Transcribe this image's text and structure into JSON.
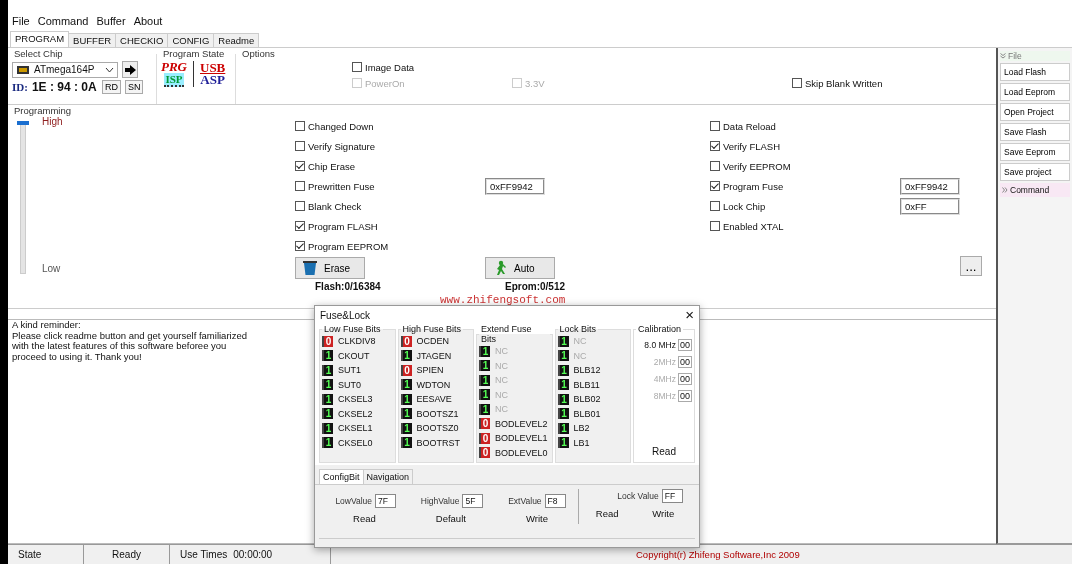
{
  "menu": [
    "File",
    "Command",
    "Buffer",
    "About"
  ],
  "tabs": [
    {
      "label": "PROGRAM",
      "selected": true
    },
    {
      "label": "BUFFER",
      "selected": false
    },
    {
      "label": "CHECKIO",
      "selected": false
    },
    {
      "label": "CONFIG",
      "selected": false
    },
    {
      "label": "Readme",
      "selected": false
    }
  ],
  "select_chip": {
    "title": "Select Chip",
    "chip": "ATmega164P",
    "id_label": "ID:",
    "id_value": "1E : 94 : 0A",
    "buttons": [
      "RD",
      "SN"
    ]
  },
  "program_state": {
    "title": "Program State",
    "prg": "PRG",
    "isp": "ISP",
    "usb": "USB",
    "asp": "ASP"
  },
  "options": {
    "title": "Options",
    "items": [
      {
        "label": "Image Data",
        "checked": false,
        "disabled": false
      },
      {
        "label": "PowerOn",
        "checked": false,
        "disabled": true
      },
      {
        "label": "3.3V",
        "checked": false,
        "disabled": true
      },
      {
        "label": "Skip Blank Written",
        "checked": false,
        "disabled": false
      }
    ]
  },
  "programming": {
    "title": "Programming",
    "high": "High",
    "low": "Low",
    "level": 1,
    "left": [
      {
        "label": "Changed Down",
        "checked": false
      },
      {
        "label": "Verify Signature",
        "checked": false
      },
      {
        "label": "Chip Erase",
        "checked": true
      },
      {
        "label": "Prewritten Fuse",
        "checked": false,
        "value": "0xFF9942"
      },
      {
        "label": "Blank Check",
        "checked": false
      },
      {
        "label": "Program FLASH",
        "checked": true
      },
      {
        "label": "Program EEPROM",
        "checked": true
      }
    ],
    "right": [
      {
        "label": "Data Reload",
        "checked": false
      },
      {
        "label": "Verify FLASH",
        "checked": true
      },
      {
        "label": "Verify EEPROM",
        "checked": false
      },
      {
        "label": "Program Fuse",
        "checked": true,
        "value": "0xFF9942"
      },
      {
        "label": "Lock Chip",
        "checked": false,
        "value": "0xFF"
      },
      {
        "label": "Enabled XTAL",
        "checked": false
      }
    ],
    "erase": "Erase",
    "flash": "Flash:0/16384",
    "auto": "Auto",
    "eprom": "Eprom:0/512",
    "more": "...",
    "site": "www.zhifengsoft.com"
  },
  "reminder": "A kind reminder:\nPlease click readme button and get yourself familiarized\nwith the latest features of this software beforee you\nproceed to using it. Thank you!",
  "side": {
    "file": "File",
    "items": [
      "Load Flash",
      "Load Eeprom",
      "Open Project",
      "Save Flash",
      "Save Eeprom",
      "Save project"
    ],
    "command": "Command"
  },
  "dialog": {
    "title": "Fuse&Lock",
    "close": "×",
    "groups": [
      {
        "title": "Low Fuse Bits",
        "bits": [
          {
            "bit": "0",
            "on": false,
            "name": "CLKDIV8",
            "disabled": false
          },
          {
            "bit": "1",
            "on": true,
            "name": "CKOUT",
            "disabled": false
          },
          {
            "bit": "1",
            "on": true,
            "name": "SUT1",
            "disabled": false
          },
          {
            "bit": "1",
            "on": true,
            "name": "SUT0",
            "disabled": false
          },
          {
            "bit": "1",
            "on": true,
            "name": "CKSEL3",
            "disabled": false
          },
          {
            "bit": "1",
            "on": true,
            "name": "CKSEL2",
            "disabled": false
          },
          {
            "bit": "1",
            "on": true,
            "name": "CKSEL1",
            "disabled": false
          },
          {
            "bit": "1",
            "on": true,
            "name": "CKSEL0",
            "disabled": false
          }
        ]
      },
      {
        "title": "High Fuse Bits",
        "bits": [
          {
            "bit": "0",
            "on": false,
            "name": "OCDEN",
            "disabled": false
          },
          {
            "bit": "1",
            "on": true,
            "name": "JTAGEN",
            "disabled": false
          },
          {
            "bit": "0",
            "on": false,
            "name": "SPIEN",
            "disabled": false
          },
          {
            "bit": "1",
            "on": true,
            "name": "WDTON",
            "disabled": false
          },
          {
            "bit": "1",
            "on": true,
            "name": "EESAVE",
            "disabled": false
          },
          {
            "bit": "1",
            "on": true,
            "name": "BOOTSZ1",
            "disabled": false
          },
          {
            "bit": "1",
            "on": true,
            "name": "BOOTSZ0",
            "disabled": false
          },
          {
            "bit": "1",
            "on": true,
            "name": "BOOTRST",
            "disabled": false
          }
        ]
      },
      {
        "title": "Extend Fuse Bits",
        "bits": [
          {
            "bit": "1",
            "on": true,
            "name": "NC",
            "disabled": true
          },
          {
            "bit": "1",
            "on": true,
            "name": "NC",
            "disabled": true
          },
          {
            "bit": "1",
            "on": true,
            "name": "NC",
            "disabled": true
          },
          {
            "bit": "1",
            "on": true,
            "name": "NC",
            "disabled": true
          },
          {
            "bit": "1",
            "on": true,
            "name": "NC",
            "disabled": true
          },
          {
            "bit": "0",
            "on": false,
            "name": "BODLEVEL2",
            "disabled": false
          },
          {
            "bit": "0",
            "on": false,
            "name": "BODLEVEL1",
            "disabled": false
          },
          {
            "bit": "0",
            "on": false,
            "name": "BODLEVEL0",
            "disabled": false
          }
        ]
      },
      {
        "title": "Lock Bits",
        "bits": [
          {
            "bit": "1",
            "on": true,
            "name": "NC",
            "disabled": true
          },
          {
            "bit": "1",
            "on": true,
            "name": "NC",
            "disabled": true
          },
          {
            "bit": "1",
            "on": true,
            "name": "BLB12",
            "disabled": false
          },
          {
            "bit": "1",
            "on": true,
            "name": "BLB11",
            "disabled": false
          },
          {
            "bit": "1",
            "on": true,
            "name": "BLB02",
            "disabled": false
          },
          {
            "bit": "1",
            "on": true,
            "name": "BLB01",
            "disabled": false
          },
          {
            "bit": "1",
            "on": true,
            "name": "LB2",
            "disabled": false
          },
          {
            "bit": "1",
            "on": true,
            "name": "LB1",
            "disabled": false
          }
        ]
      }
    ],
    "calibration": {
      "title": "Calibration",
      "rows": [
        {
          "label": "8.0 MHz",
          "value": "00",
          "disabled": false
        },
        {
          "label": "2MHz",
          "value": "00",
          "disabled": true
        },
        {
          "label": "4MHz",
          "value": "00",
          "disabled": true
        },
        {
          "label": "8MHz",
          "value": "00",
          "disabled": true
        }
      ],
      "read": "Read"
    },
    "tabs": [
      {
        "label": "ConfigBit",
        "selected": true
      },
      {
        "label": "Navigation",
        "selected": false
      }
    ],
    "values": [
      {
        "label": "LowValue",
        "value": "7F"
      },
      {
        "label": "HighValue",
        "value": "5F"
      },
      {
        "label": "ExtValue",
        "value": "F8"
      }
    ],
    "fuse_buttons": [
      "Read",
      "Default",
      "Write"
    ],
    "lock": {
      "label": "Lock Value",
      "value": "FF"
    },
    "lock_buttons": [
      "Read",
      "Write"
    ]
  },
  "status": {
    "state": "State",
    "ready": "Ready",
    "use_times": "Use Times",
    "time": "00:00:00",
    "copyright": "Copyright(r) Zhifeng Software,Inc 2009"
  }
}
